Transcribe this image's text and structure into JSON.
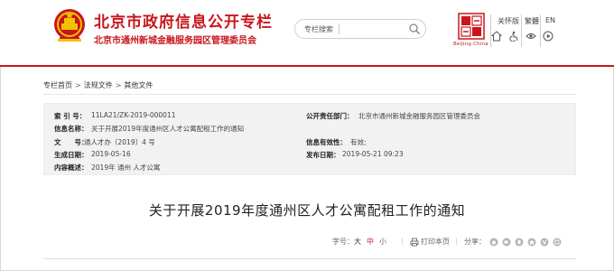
{
  "header": {
    "title": "北京市政府信息公开专栏",
    "subtitle": "北京市通州新城金融服务园区管理委员会",
    "search_placeholder": "专栏搜索",
    "logo_caption": "Beijing·China",
    "tools": {
      "elder": "关怀版",
      "traditional": "繁體",
      "english": "EN"
    },
    "colors": {
      "brand_red": "#c8161d"
    }
  },
  "breadcrumb": [
    "专栏首页",
    "法规文件",
    "其他文件"
  ],
  "breadcrumb_separator": ">",
  "info": {
    "index_label": "索 引 号：",
    "index_value": "11LA21/ZK-2019-000011",
    "publisher_label": "公开责任部门：",
    "publisher_value": "北京市通州新城金融服务园区管理委员会",
    "title_label": "信息名称：",
    "title_value": "关于开展2019年度通州区人才公寓配租工作的通知",
    "docno_label": "文　　号：",
    "docno_value": "通人才办〔2019〕4 号",
    "validity_label": "信息有效性：",
    "validity_value": "有效;",
    "created_label": "生成日期：",
    "created_value": "2019-05-16",
    "published_label": "发布日期：",
    "published_value": "2019-05-21 09:23",
    "category_label": "内容概述：",
    "category_value": "2019年 通州 人才公寓"
  },
  "article": {
    "title": "关于开展2019年度通州区人才公寓配租工作的通知",
    "font_size_label": "字号：",
    "size_large": "大",
    "size_medium": "中",
    "size_small": "小",
    "print_label": "打印本页",
    "share_label": "分享："
  }
}
